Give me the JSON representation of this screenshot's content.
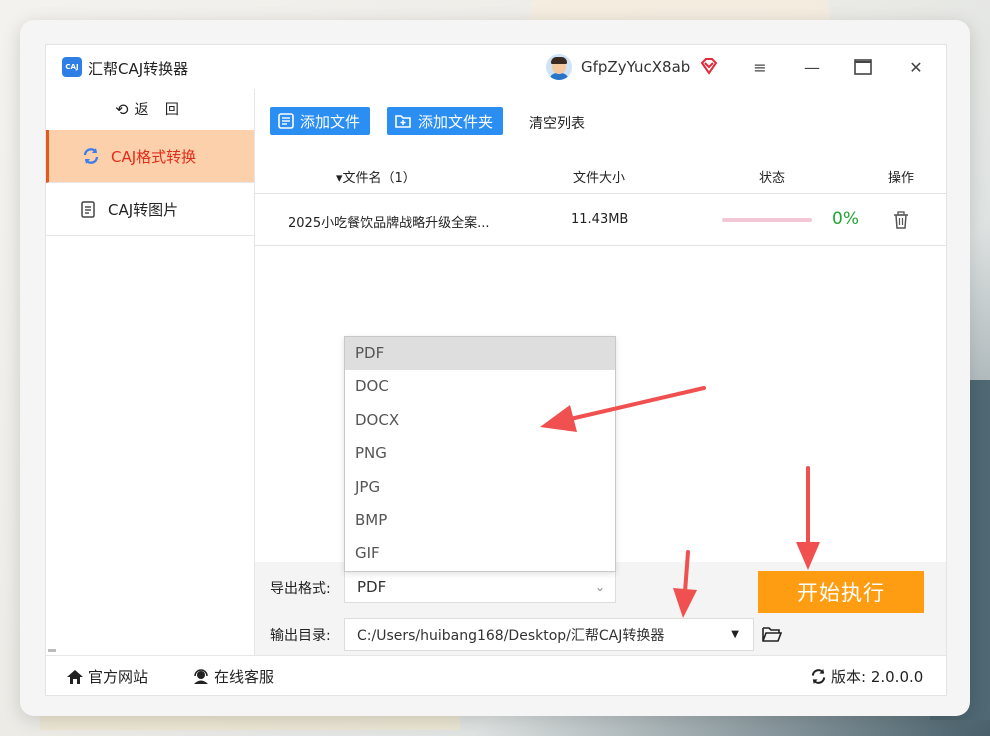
{
  "app": {
    "title": "汇帮CAJ转换器",
    "logo_text": "CAJ",
    "username": "GfpZyYucX8ab"
  },
  "window_controls": {
    "menu": "≡",
    "minimize": "—",
    "maximize": "▭",
    "close": "✕"
  },
  "sidebar": {
    "back_label": "返 回",
    "items": [
      {
        "label": "CAJ格式转换",
        "icon": "refresh-icon",
        "active": true
      },
      {
        "label": "CAJ转图片",
        "icon": "document-icon",
        "active": false
      }
    ]
  },
  "toolbar": {
    "add_file": "添加文件",
    "add_folder": "添加文件夹",
    "clear_list": "清空列表"
  },
  "table": {
    "columns": {
      "filename": "▾文件名（1）",
      "size": "文件大小",
      "status": "状态",
      "action": "操作"
    },
    "rows": [
      {
        "filename": "2025小吃餐饮品牌战略升级全案...",
        "size": "11.43MB",
        "progress": 0,
        "progress_label": "0%"
      }
    ]
  },
  "export": {
    "format_label": "导出格式:",
    "format_value": "PDF",
    "format_options": [
      "PDF",
      "DOC",
      "DOCX",
      "PNG",
      "JPG",
      "BMP",
      "GIF"
    ],
    "output_label": "输出目录:",
    "output_value": "C:/Users/huibang168/Desktop/汇帮CAJ转换器"
  },
  "start_button": "开始执行",
  "statusbar": {
    "website": "官方网站",
    "support": "在线客服",
    "version": "版本: 2.0.0.0"
  },
  "colors": {
    "accent_blue": "#2b8ef3",
    "active_bg": "#fbd0ab",
    "active_text": "#e42b1a",
    "start_orange": "#ff9d12",
    "progress_green": "#21a531",
    "annotation_red": "#f0504f"
  }
}
